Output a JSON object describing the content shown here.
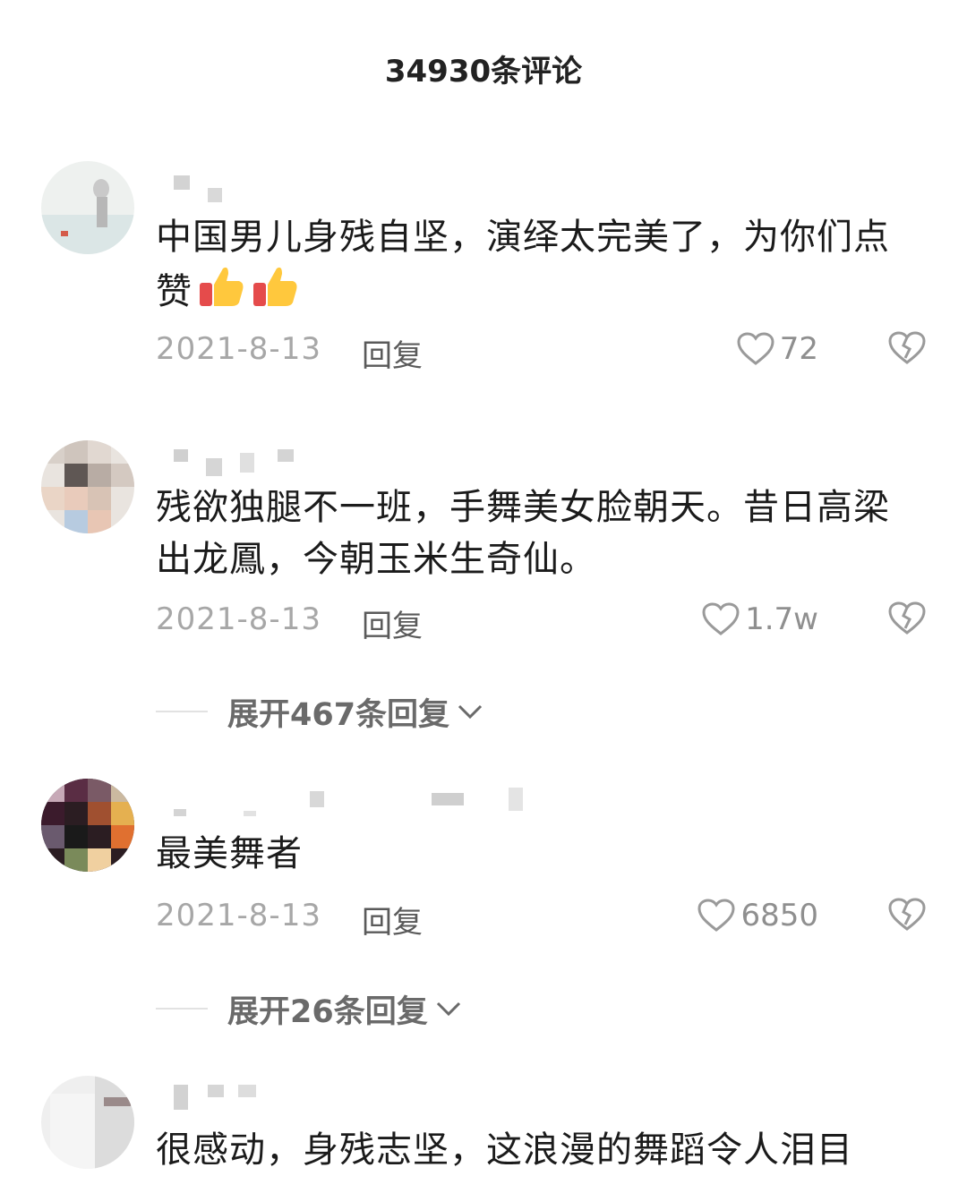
{
  "header": {
    "title": "34930条评论"
  },
  "comments": [
    {
      "text": "中国男儿身残自坚，演绎太完美了，为你们点赞",
      "date": "2021-8-13",
      "reply_label": "回复",
      "likes": "72"
    },
    {
      "text": "残欲独腿不一班，手舞美女脸朝天。昔日高梁 出龙鳳，今朝玉米生奇仙。",
      "date": "2021-8-13",
      "reply_label": "回复",
      "likes": "1.7w",
      "expand_label": "展开467条回复"
    },
    {
      "text": "最美舞者",
      "date": "2021-8-13",
      "reply_label": "回复",
      "likes": "6850",
      "expand_label": "展开26条回复"
    },
    {
      "text": "很感动，身残志坚，这浪漫的舞蹈令人泪目"
    }
  ],
  "icons": {
    "like": "heart-outline-icon",
    "dislike": "broken-heart-icon",
    "expand": "chevron-down-icon",
    "emoji": "thumbs-up-icon"
  },
  "colors": {
    "meta_gray": "#a7a7a7",
    "reply_gray": "#5a5a5a",
    "text": "#1b1b1b"
  }
}
